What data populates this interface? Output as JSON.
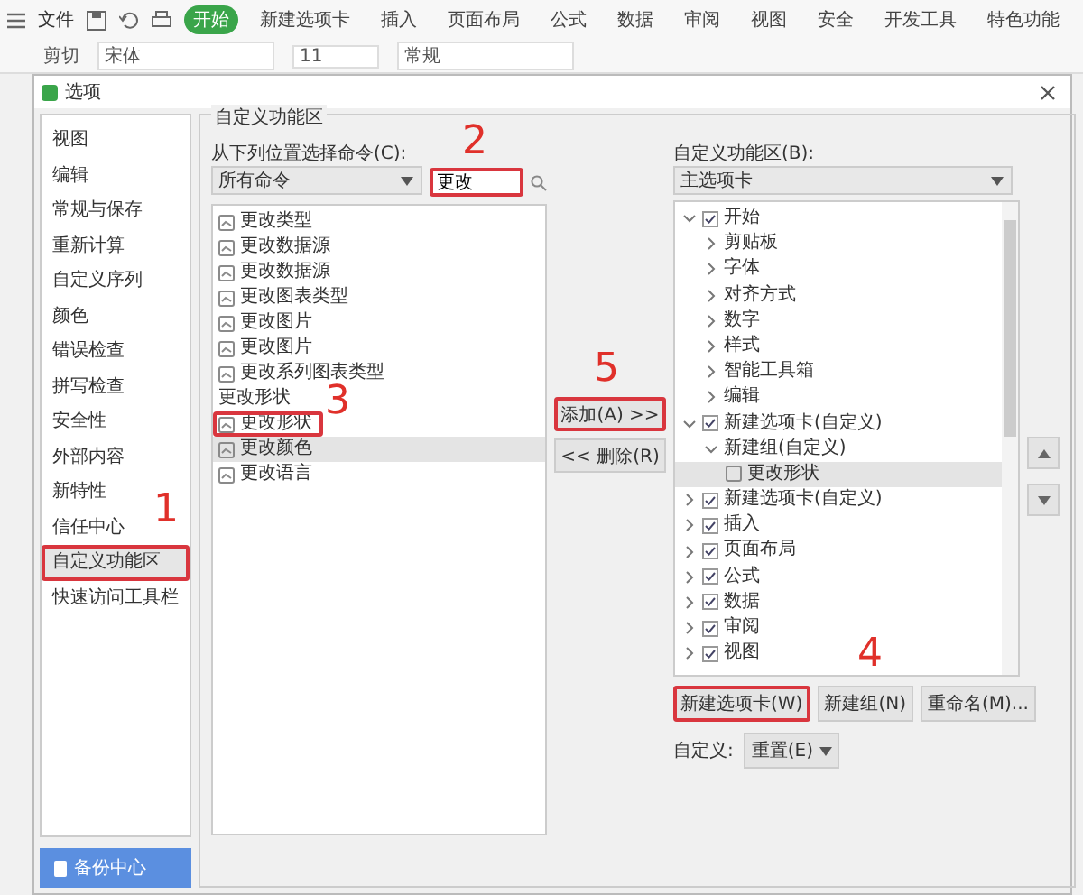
{
  "menu_bar": {
    "file_label": "文件",
    "tabs": [
      {
        "label": "开始",
        "selected": true
      },
      {
        "label": "新建选项卡",
        "selected": false
      },
      {
        "label": "插入",
        "selected": false
      },
      {
        "label": "页面布局",
        "selected": false
      },
      {
        "label": "公式",
        "selected": false
      },
      {
        "label": "数据",
        "selected": false
      },
      {
        "label": "审阅",
        "selected": false
      },
      {
        "label": "视图",
        "selected": false
      },
      {
        "label": "安全",
        "selected": false
      },
      {
        "label": "开发工具",
        "selected": false
      },
      {
        "label": "特色功能",
        "selected": false
      }
    ]
  },
  "toolbar": {
    "cut": "剪切",
    "font": "宋体",
    "size": "11",
    "format": "常规"
  },
  "dialog": {
    "title": "选项",
    "sidebar": {
      "items": [
        {
          "label": "视图",
          "selected": false,
          "highlighted": false
        },
        {
          "label": "编辑",
          "selected": false,
          "highlighted": false
        },
        {
          "label": "常规与保存",
          "selected": false,
          "highlighted": false
        },
        {
          "label": "重新计算",
          "selected": false,
          "highlighted": false
        },
        {
          "label": "自定义序列",
          "selected": false,
          "highlighted": false
        },
        {
          "label": "颜色",
          "selected": false,
          "highlighted": false
        },
        {
          "label": "错误检查",
          "selected": false,
          "highlighted": false
        },
        {
          "label": "拼写检查",
          "selected": false,
          "highlighted": false
        },
        {
          "label": "安全性",
          "selected": false,
          "highlighted": false
        },
        {
          "label": "外部内容",
          "selected": false,
          "highlighted": false
        },
        {
          "label": "新特性",
          "selected": false,
          "highlighted": false
        },
        {
          "label": "信任中心",
          "selected": false,
          "highlighted": false
        },
        {
          "label": "自定义功能区",
          "selected": true,
          "highlighted": true,
          "callout": "1"
        },
        {
          "label": "快速访问工具栏",
          "selected": false,
          "highlighted": false
        }
      ],
      "backup_button": "备份中心"
    },
    "group_label": "自定义功能区",
    "commands": {
      "label": "从下列位置选择命令(C):",
      "source": "所有命令",
      "search": {
        "value": "更改",
        "highlighted": true,
        "callout": "2"
      },
      "items": [
        {
          "label": "更改类型",
          "kind": "command",
          "selected": false,
          "highlighted": false
        },
        {
          "label": "更改数据源",
          "kind": "command",
          "selected": false,
          "highlighted": false
        },
        {
          "label": "更改数据源",
          "kind": "command",
          "selected": false,
          "highlighted": false
        },
        {
          "label": "更改图表类型",
          "kind": "command",
          "selected": false,
          "highlighted": false
        },
        {
          "label": "更改图片",
          "kind": "command",
          "selected": false,
          "highlighted": false
        },
        {
          "label": "更改图片",
          "kind": "command",
          "selected": false,
          "highlighted": false
        },
        {
          "label": "更改系列图表类型",
          "kind": "command",
          "selected": false,
          "highlighted": false
        },
        {
          "label": "更改形状",
          "kind": "header",
          "selected": false,
          "highlighted": false
        },
        {
          "label": "更改形状",
          "kind": "command",
          "selected": false,
          "highlighted": true,
          "callout": "3"
        },
        {
          "label": "更改颜色",
          "kind": "command",
          "selected": true,
          "highlighted": false
        },
        {
          "label": "更改语言",
          "kind": "command",
          "selected": false,
          "highlighted": false
        }
      ]
    },
    "add_button": {
      "label": "添加(A) >>",
      "highlighted": true,
      "callout": "5"
    },
    "remove_button": "<< 删除(R)",
    "ribbon": {
      "label": "自定义功能区(B):",
      "source": "主选项卡",
      "tree": [
        {
          "label": "开始",
          "checked": true,
          "expanded": true,
          "selected": false,
          "children": [
            {
              "label": "剪贴板",
              "expanded": false,
              "selected": false
            },
            {
              "label": "字体",
              "expanded": false,
              "selected": false
            },
            {
              "label": "对齐方式",
              "expanded": false,
              "selected": false
            },
            {
              "label": "数字",
              "expanded": false,
              "selected": false
            },
            {
              "label": "样式",
              "expanded": false,
              "selected": false
            },
            {
              "label": "智能工具箱",
              "expanded": false,
              "selected": false
            },
            {
              "label": "编辑",
              "expanded": false,
              "selected": false
            }
          ]
        },
        {
          "label": "新建选项卡(自定义)",
          "checked": true,
          "expanded": true,
          "selected": false,
          "children": [
            {
              "label": "新建组(自定义)",
              "expanded": true,
              "selected": false,
              "children": [
                {
                  "label": "更改形状",
                  "selected": true
                }
              ]
            }
          ]
        },
        {
          "label": "新建选项卡(自定义)",
          "checked": true,
          "expanded": false,
          "selected": false
        },
        {
          "label": "插入",
          "checked": true,
          "expanded": false,
          "selected": false
        },
        {
          "label": "页面布局",
          "checked": true,
          "expanded": false,
          "selected": false
        },
        {
          "label": "公式",
          "checked": true,
          "expanded": false,
          "selected": false
        },
        {
          "label": "数据",
          "checked": true,
          "expanded": false,
          "selected": false
        },
        {
          "label": "审阅",
          "checked": true,
          "expanded": false,
          "selected": false
        },
        {
          "label": "视图",
          "checked": true,
          "expanded": false,
          "selected": false
        }
      ],
      "buttons": [
        {
          "label": "新建选项卡(W)",
          "highlighted": true,
          "callout": "4"
        },
        {
          "label": "新建组(N)",
          "highlighted": false
        },
        {
          "label": "重命名(M)...",
          "highlighted": false
        }
      ],
      "customize_label": "自定义:",
      "reset": "重置(E)"
    }
  }
}
